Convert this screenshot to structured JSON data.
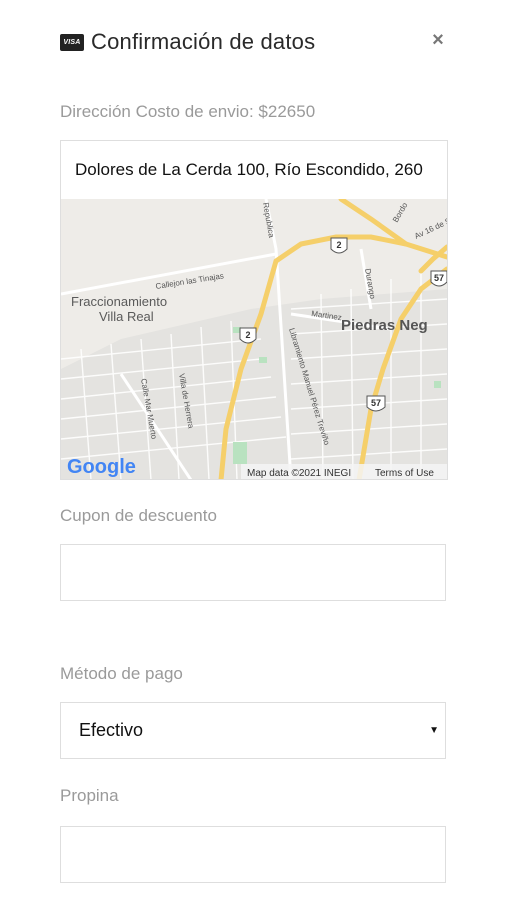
{
  "header": {
    "card_badge": "VISA",
    "card_icon": "visa-card-icon",
    "title": "Confirmación de datos",
    "close_icon": "×"
  },
  "address": {
    "label": "Dirección Costo de envio: $22650",
    "value": "Dolores de La Cerda 100, Río Escondido, 260"
  },
  "map": {
    "place_label_1a": "Fraccionamiento",
    "place_label_1b": "Villa Real",
    "city_label": "Piedras Neg",
    "streets": {
      "republica": "Republica",
      "bordo": "Bordo",
      "av16": "Av 16 de Se",
      "callejon": "Callejon las Tinajas",
      "durango": "Durango",
      "martinez": "Martinez",
      "libramiento": "Libramiento Manuel Pérez Treviño",
      "villa_herrera": "Villa de Herrera",
      "calle_mar_muerto": "Calle Mar Muerto"
    },
    "shields": [
      "2",
      "2",
      "2",
      "57",
      "57"
    ],
    "google_logo": "Google",
    "attribution": "Map data ©2021 INEGI",
    "terms": "Terms of Use"
  },
  "coupon": {
    "label": "Cupon de descuento",
    "value": ""
  },
  "payment": {
    "label": "Método de pago",
    "selected": "Efectivo"
  },
  "tip": {
    "label": "Propina",
    "value": ""
  }
}
